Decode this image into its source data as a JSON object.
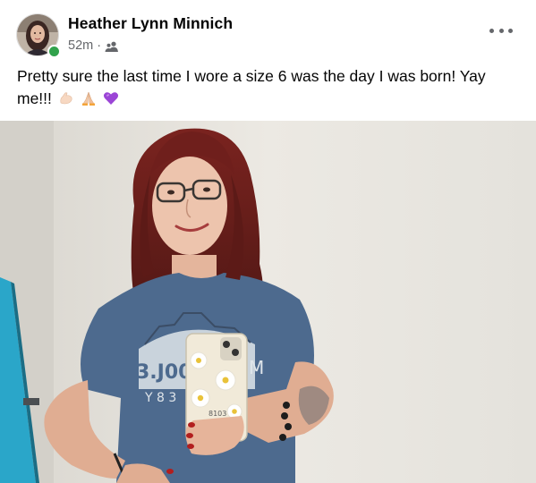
{
  "post": {
    "author": "Heather Lynn Minnich",
    "time": "52m",
    "separator": "·",
    "audience_icon": "friends-icon",
    "text": "Pretty sure the last time I wore a size 6 was the day I was born! Yay me!!!",
    "emojis": [
      "flexed-biceps-emoji",
      "folded-hands-emoji",
      "purple-heart-emoji"
    ],
    "more_icon": "ellipsis-icon"
  },
  "photo": {
    "phone_case_text": [
      "3.J00I",
      "Y 8 3",
      "M",
      "8103"
    ]
  },
  "colors": {
    "online": "#31a24c",
    "secondary_text": "#65676b",
    "shirt": "#4d6a8e",
    "hair": "#6f1f1c",
    "wall": "#e9e6df"
  }
}
